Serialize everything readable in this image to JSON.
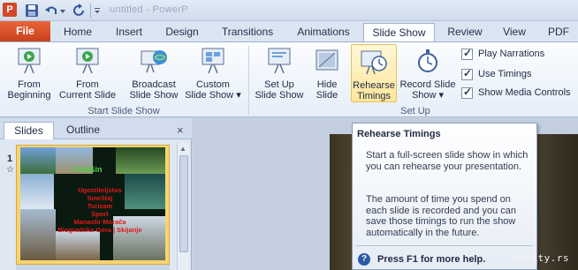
{
  "titlebar": {
    "app_icon_letter": "P",
    "doc_title": "untitled - PowerP"
  },
  "tabs": [
    {
      "label": "File"
    },
    {
      "label": "Home"
    },
    {
      "label": "Insert"
    },
    {
      "label": "Design"
    },
    {
      "label": "Transitions"
    },
    {
      "label": "Animations"
    },
    {
      "label": "Slide Show"
    },
    {
      "label": "Review"
    },
    {
      "label": "View"
    },
    {
      "label": "PDF"
    }
  ],
  "ribbon": {
    "start_group": {
      "label": "Start Slide Show",
      "from_beginning": [
        "From",
        "Beginning"
      ],
      "from_current": [
        "From",
        "Current Slide"
      ],
      "broadcast": [
        "Broadcast",
        "Slide Show"
      ],
      "custom": [
        "Custom",
        "Slide Show ▾"
      ]
    },
    "setup_group": {
      "label": "Set Up",
      "setup": [
        "Set Up",
        "Slide Show"
      ],
      "hide": [
        "Hide",
        "Slide"
      ],
      "rehearse": [
        "Rehearse",
        "Timings"
      ],
      "record": [
        "Record Slide",
        "Show ▾"
      ],
      "play_narrations": "Play Narrations",
      "use_timings": "Use Timings",
      "show_media_controls": "Show Media Controls"
    }
  },
  "left_pane": {
    "tab_slides": "Slides",
    "tab_outline": "Outline",
    "close": "×",
    "slide_number": "1",
    "thumb_title": "Kolašin",
    "thumb_lines": [
      "Ugostiteljstvo",
      "Smeštaj",
      "Turizam",
      "Sport",
      "Manastir Morača",
      "Biogradska Gora | Skijanje"
    ]
  },
  "tooltip": {
    "title": "Rehearse Timings",
    "para1": "Start a full-screen slide show in which you can rehearse your presentation.",
    "para2": "The amount of time you spend on each slide is recorded and you can save those timings to run the show automatically in the future.",
    "help": "Press F1 for more help."
  },
  "watermark": "mycity.rs"
}
